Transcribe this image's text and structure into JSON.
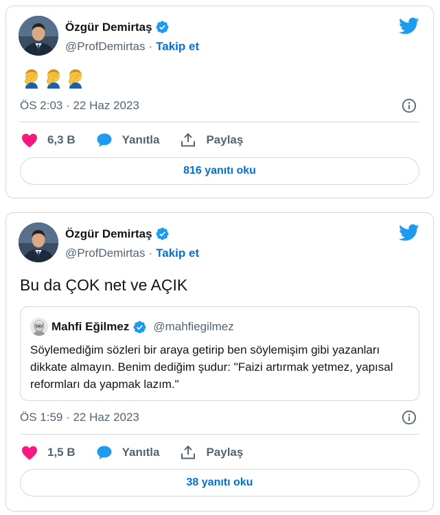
{
  "colors": {
    "accent": "#1d9bf0",
    "link": "#006fd6",
    "like": "#f91880",
    "muted": "#536471",
    "border": "#cfd9de"
  },
  "tweets": [
    {
      "author": {
        "name": "Özgür Demirtaş",
        "handle": "@ProfDemirtas",
        "separator": "·",
        "follow": "Takip et"
      },
      "text": "",
      "emoji": "man-facepalming-emoji x3",
      "timestamp": "ÖS 2:03 · 22 Haz 2023",
      "likes": "6,3 B",
      "reply_label": "Yanıtla",
      "share_label": "Paylaş",
      "read_replies": "816 yanıtı oku"
    },
    {
      "author": {
        "name": "Özgür Demirtaş",
        "handle": "@ProfDemirtas",
        "separator": "·",
        "follow": "Takip et"
      },
      "text": "Bu da ÇOK net ve AÇIK",
      "quote": {
        "name": "Mahfi Eğilmez",
        "handle": "@mahfiegilmez",
        "text": "Söylemediğim sözleri bir araya getirip ben söylemişim gibi yazanları dikkate almayın. Benim dediğim şudur: \"Faizi artırmak yetmez, yapısal reformları da yapmak lazım.\""
      },
      "timestamp": "ÖS 1:59 · 22 Haz 2023",
      "likes": "1,5 B",
      "reply_label": "Yanıtla",
      "share_label": "Paylaş",
      "read_replies": "38 yanıtı oku"
    }
  ]
}
